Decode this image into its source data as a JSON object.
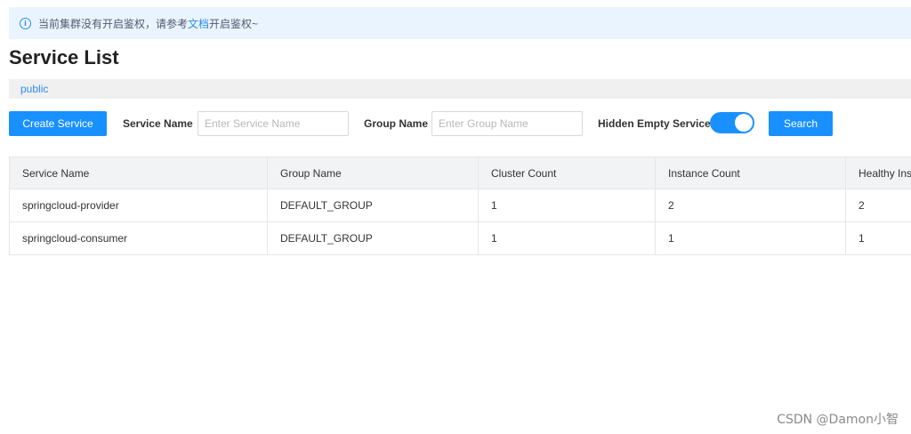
{
  "alert": {
    "text_before": "当前集群没有开启鉴权，请参考",
    "link": "文档",
    "text_after": "开启鉴权~"
  },
  "page_title": "Service List",
  "namespace": {
    "current": "public"
  },
  "toolbar": {
    "create_label": "Create Service",
    "service_name_label": "Service Name",
    "service_name_placeholder": "Enter Service Name",
    "group_name_label": "Group Name",
    "group_name_placeholder": "Enter Group Name",
    "hidden_empty_label": "Hidden Empty Service",
    "hidden_empty_on": true,
    "search_label": "Search"
  },
  "table": {
    "columns": [
      "Service Name",
      "Group Name",
      "Cluster Count",
      "Instance Count",
      "Healthy Inst"
    ],
    "rows": [
      [
        "springcloud-provider",
        "DEFAULT_GROUP",
        "1",
        "2",
        "2"
      ],
      [
        "springcloud-consumer",
        "DEFAULT_GROUP",
        "1",
        "1",
        "1"
      ]
    ]
  },
  "watermark": "CSDN @Damon小智",
  "colors": {
    "primary": "#1890ff",
    "link": "#2d8cf0",
    "alert_bg": "#eaf4fe"
  }
}
